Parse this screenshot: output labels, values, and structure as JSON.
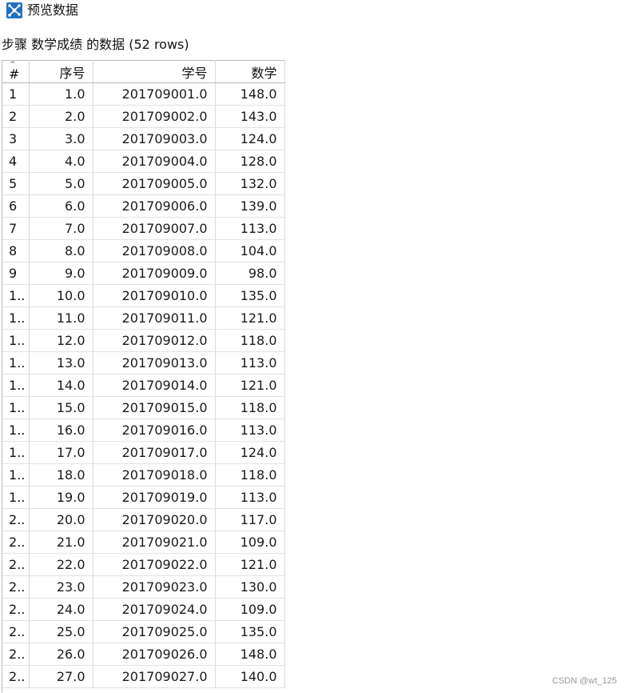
{
  "window": {
    "title": "预览数据",
    "icon": "network-nodes-icon",
    "icon_color": "#1f6fc5"
  },
  "caption": "步骤 数学成绩 的数据 (52 rows)",
  "table": {
    "columns": [
      "#",
      "序号",
      "学号",
      "数学"
    ],
    "rows": [
      [
        "1",
        "1.0",
        "201709001.0",
        "148.0"
      ],
      [
        "2",
        "2.0",
        "201709002.0",
        "143.0"
      ],
      [
        "3",
        "3.0",
        "201709003.0",
        "124.0"
      ],
      [
        "4",
        "4.0",
        "201709004.0",
        "128.0"
      ],
      [
        "5",
        "5.0",
        "201709005.0",
        "132.0"
      ],
      [
        "6",
        "6.0",
        "201709006.0",
        "139.0"
      ],
      [
        "7",
        "7.0",
        "201709007.0",
        "113.0"
      ],
      [
        "8",
        "8.0",
        "201709008.0",
        "104.0"
      ],
      [
        "9",
        "9.0",
        "201709009.0",
        "98.0"
      ],
      [
        "1..",
        "10.0",
        "201709010.0",
        "135.0"
      ],
      [
        "1..",
        "11.0",
        "201709011.0",
        "121.0"
      ],
      [
        "1..",
        "12.0",
        "201709012.0",
        "118.0"
      ],
      [
        "1..",
        "13.0",
        "201709013.0",
        "113.0"
      ],
      [
        "1..",
        "14.0",
        "201709014.0",
        "121.0"
      ],
      [
        "1..",
        "15.0",
        "201709015.0",
        "118.0"
      ],
      [
        "1..",
        "16.0",
        "201709016.0",
        "113.0"
      ],
      [
        "1..",
        "17.0",
        "201709017.0",
        "124.0"
      ],
      [
        "1..",
        "18.0",
        "201709018.0",
        "118.0"
      ],
      [
        "1..",
        "19.0",
        "201709019.0",
        "113.0"
      ],
      [
        "2..",
        "20.0",
        "201709020.0",
        "117.0"
      ],
      [
        "2..",
        "21.0",
        "201709021.0",
        "109.0"
      ],
      [
        "2..",
        "22.0",
        "201709022.0",
        "121.0"
      ],
      [
        "2..",
        "23.0",
        "201709023.0",
        "130.0"
      ],
      [
        "2..",
        "24.0",
        "201709024.0",
        "109.0"
      ],
      [
        "2..",
        "25.0",
        "201709025.0",
        "135.0"
      ],
      [
        "2..",
        "26.0",
        "201709026.0",
        "148.0"
      ],
      [
        "2..",
        "27.0",
        "201709027.0",
        "140.0"
      ]
    ]
  },
  "watermark": "CSDN @wt_125"
}
